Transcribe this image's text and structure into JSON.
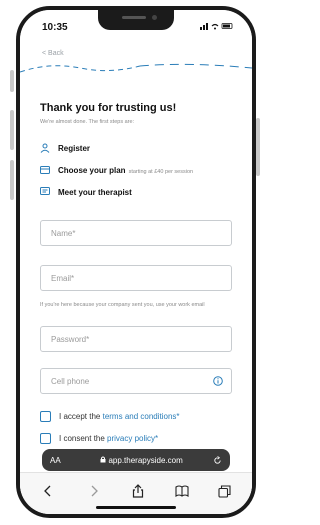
{
  "status": {
    "time": "10:35",
    "icons": "signal-wifi-battery"
  },
  "nav": {
    "back_label": "< Back"
  },
  "header": {
    "title": "Thank you for trusting us!",
    "subtitle": "We're almost done. The first steps are:"
  },
  "steps": [
    {
      "icon": "person-icon",
      "label": "Register",
      "note": ""
    },
    {
      "icon": "card-icon",
      "label": "Choose your plan",
      "note": "starting at £40 per session"
    },
    {
      "icon": "chat-icon",
      "label": "Meet your therapist",
      "note": ""
    }
  ],
  "form": {
    "name_placeholder": "Name*",
    "email_placeholder": "Email*",
    "email_helper": "If you're here because your company sent you, use your work email",
    "password_placeholder": "Password*",
    "phone_placeholder": "Cell phone",
    "accept_prefix": "I accept the ",
    "accept_link": "terms and conditions*",
    "privacy_prefix": "I consent the ",
    "privacy_link": "privacy policy*"
  },
  "browser": {
    "aa_label": "AA",
    "url": "app.therapyside.com"
  },
  "colors": {
    "accent": "#2a7db8"
  }
}
